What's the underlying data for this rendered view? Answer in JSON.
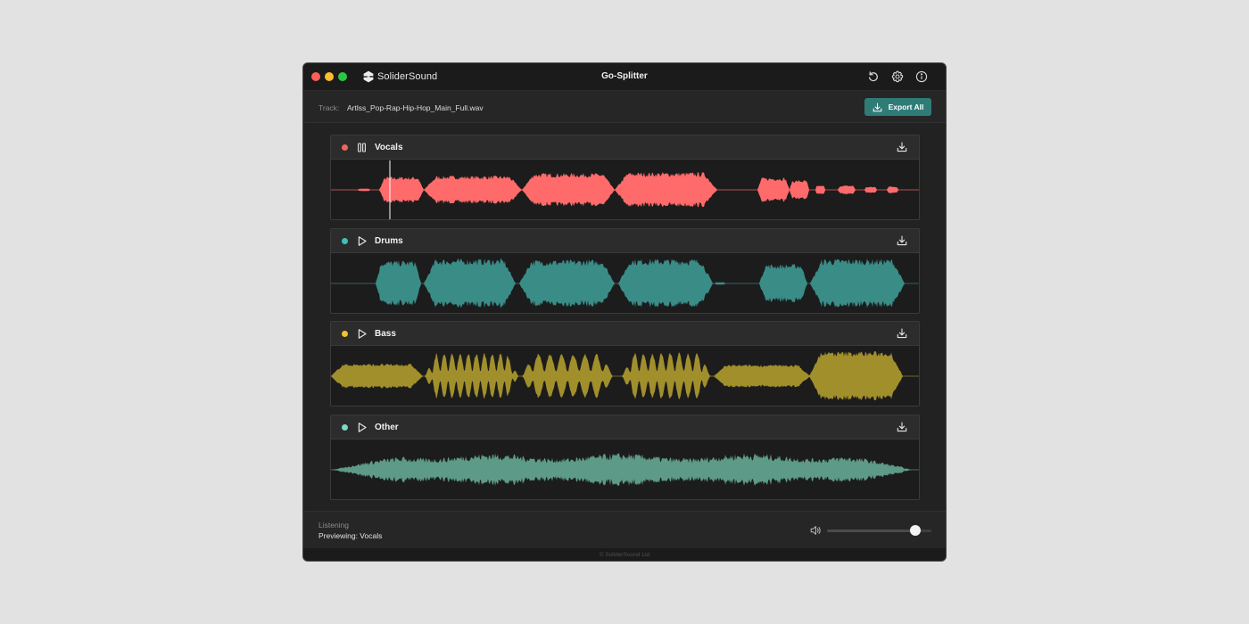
{
  "window": {
    "app_name": "SoliderSound",
    "title": "Go-Splitter",
    "toolbar_icons": [
      "refresh-icon",
      "gear-icon",
      "info-icon"
    ]
  },
  "track": {
    "label": "Track:",
    "filename": "Artlss_Pop-Rap-Hip-Hop_Main_Full.wav",
    "export_label": "Export All"
  },
  "stems": [
    {
      "name": "Vocals",
      "color": "#ff6b6b",
      "state": "playing",
      "control_icon": "pause-icon"
    },
    {
      "name": "Drums",
      "color": "#3a8c87",
      "state": "stopped",
      "control_icon": "play-icon"
    },
    {
      "name": "Bass",
      "color": "#a18f2c",
      "state": "stopped",
      "control_icon": "play-icon"
    },
    {
      "name": "Other",
      "color": "#5e9a88",
      "state": "stopped",
      "control_icon": "play-icon"
    }
  ],
  "dot_colors": [
    "#f0645c",
    "#3fbfb8",
    "#f2c230",
    "#7fd8c4"
  ],
  "playhead_position": 0.1,
  "status": {
    "line1": "Listening",
    "line2": "Previewing: Vocals"
  },
  "volume": {
    "level": 0.85
  },
  "footer": {
    "copyright": "© SoliderSound Ltd"
  }
}
